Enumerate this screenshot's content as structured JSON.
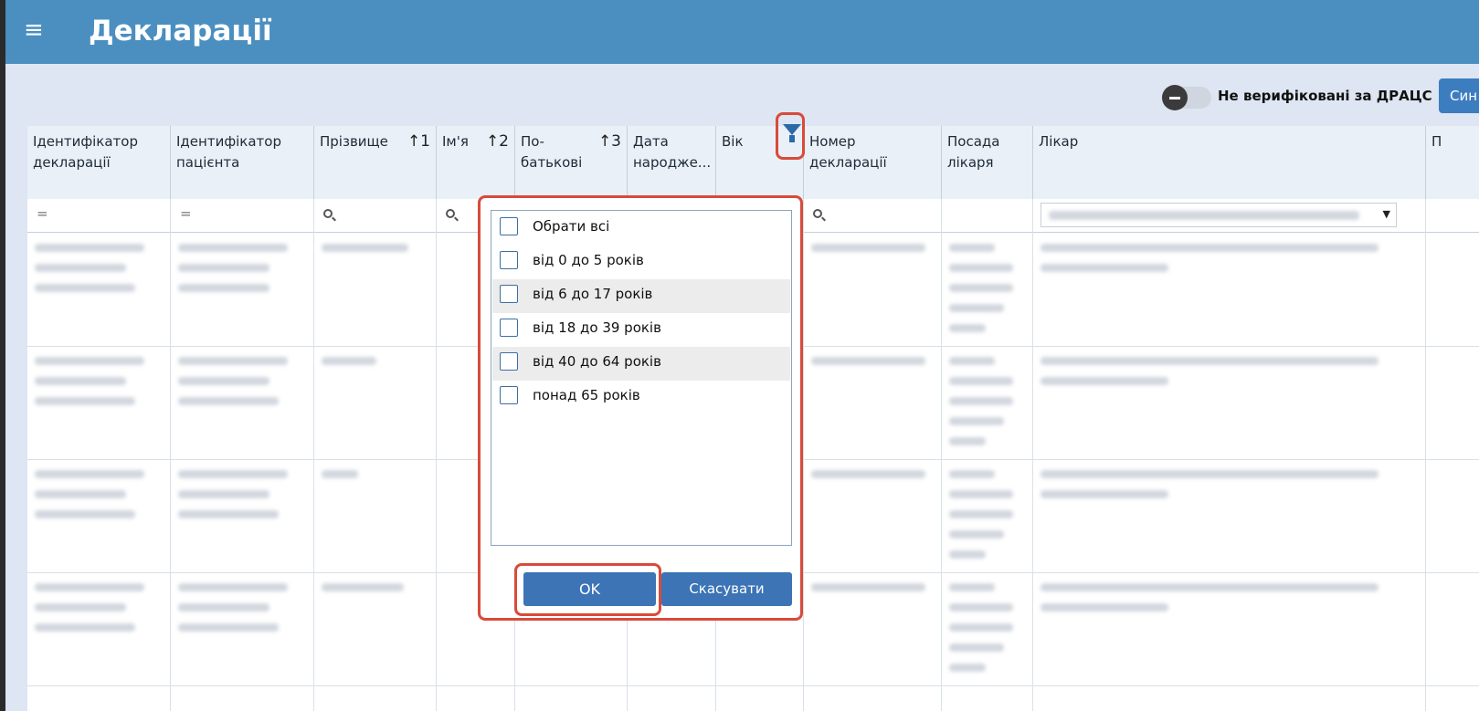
{
  "app": {
    "title": "Декларації",
    "menu_icon": "≡"
  },
  "toolbar": {
    "toggle_label": "Не верифіковані за ДРАЦС",
    "sync_label": "Син"
  },
  "columns": [
    {
      "label": "Ідентифікатор декларації",
      "sort": ""
    },
    {
      "label": "Ідентифікатор пацієнта",
      "sort": ""
    },
    {
      "label": "Прізвище",
      "sort": "↑1"
    },
    {
      "label": "Ім'я",
      "sort": "↑2"
    },
    {
      "label": "По-батькові",
      "sort": "↑3"
    },
    {
      "label": "Дата народже...",
      "sort": ""
    },
    {
      "label": "Вік",
      "sort": ""
    },
    {
      "label": "Номер декларації",
      "sort": ""
    },
    {
      "label": "Посада лікаря",
      "sort": ""
    },
    {
      "label": "Лікар",
      "sort": ""
    },
    {
      "label": "П",
      "sort": ""
    }
  ],
  "filters": {
    "equals_symbol": "="
  },
  "age_filter": {
    "options": [
      {
        "label": "Обрати всі"
      },
      {
        "label": "від 0 до 5 років"
      },
      {
        "label": "від 6 до 17 років"
      },
      {
        "label": "від 18 до 39 років"
      },
      {
        "label": "від 40 до 64 років"
      },
      {
        "label": "понад 65 років"
      }
    ],
    "ok_label": "OK",
    "cancel_label": "Скасувати"
  }
}
